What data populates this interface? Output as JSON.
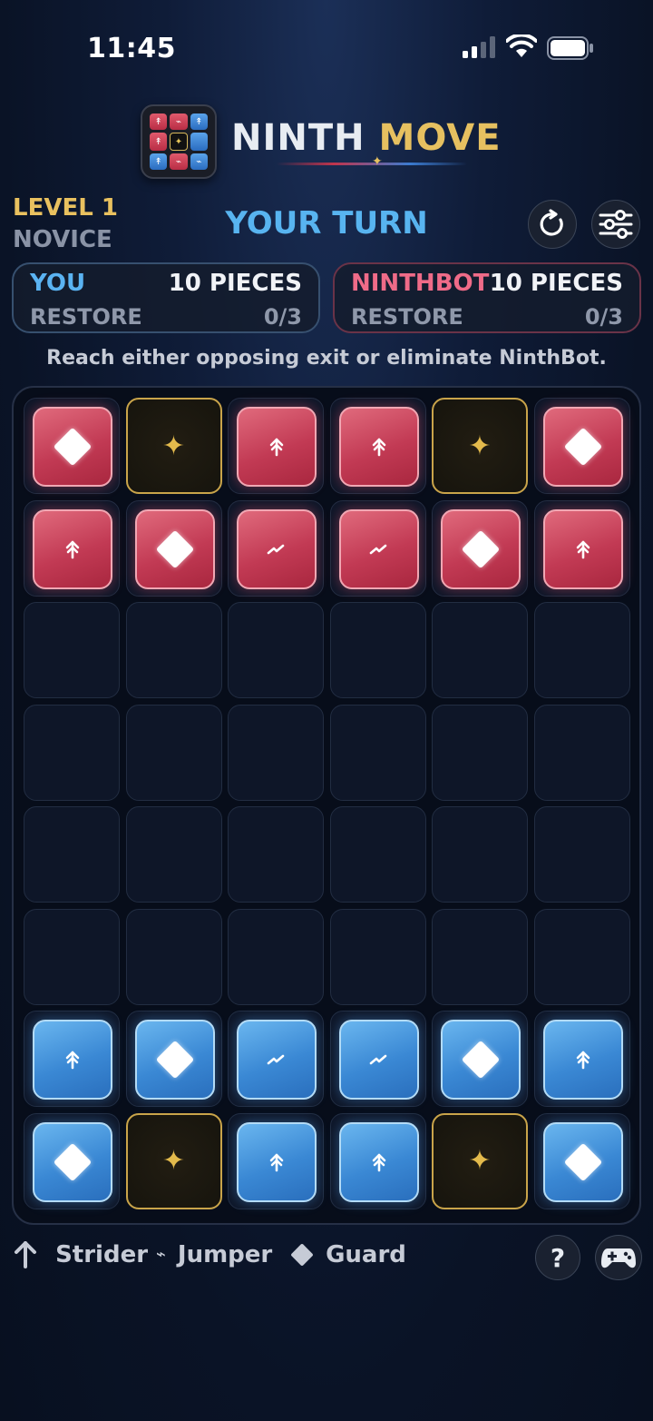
{
  "status_bar": {
    "time": "11:45"
  },
  "logo": {
    "word1": "NINTH",
    "word2": "MOVE"
  },
  "header": {
    "level": "LEVEL 1",
    "difficulty": "NOVICE",
    "turn": "YOUR TURN",
    "restart_icon": "restart-icon",
    "settings_icon": "settings-sliders-icon"
  },
  "players": {
    "you": {
      "name": "YOU",
      "pieces": "10 PIECES",
      "restore_label": "RESTORE",
      "restore_count": "0/3",
      "color": "#5ab3f2"
    },
    "bot": {
      "name": "NINTHBOT",
      "pieces": "10 PIECES",
      "restore_label": "RESTORE",
      "restore_count": "0/3",
      "color": "#ef6b88"
    }
  },
  "hint": "Reach either opposing exit or eliminate NinthBot.",
  "board": {
    "rows": 8,
    "cols": 6,
    "cells": [
      [
        "red:guard",
        "exit",
        "red:strider",
        "red:strider",
        "exit",
        "red:guard"
      ],
      [
        "red:strider",
        "red:guard",
        "red:jumper",
        "red:jumper",
        "red:guard",
        "red:strider"
      ],
      [
        "",
        "",
        "",
        "",
        "",
        ""
      ],
      [
        "",
        "",
        "",
        "",
        "",
        ""
      ],
      [
        "",
        "",
        "",
        "",
        "",
        ""
      ],
      [
        "",
        "",
        "",
        "",
        "",
        ""
      ],
      [
        "blue:strider",
        "blue:guard",
        "blue:jumper",
        "blue:jumper",
        "blue:guard",
        "blue:strider"
      ],
      [
        "blue:guard",
        "exit",
        "blue:strider",
        "blue:strider",
        "exit",
        "blue:guard"
      ]
    ]
  },
  "legend": {
    "strider": "Strider",
    "jumper": "Jumper",
    "guard": "Guard"
  },
  "footer": {
    "help_icon": "help-icon",
    "gamepad_icon": "gamepad-icon"
  },
  "colors": {
    "red_piece": "#c23a54",
    "blue_piece": "#3a88d4",
    "exit_gold": "#c9a44a",
    "turn": "#58b4f0",
    "level": "#e9c15f"
  }
}
